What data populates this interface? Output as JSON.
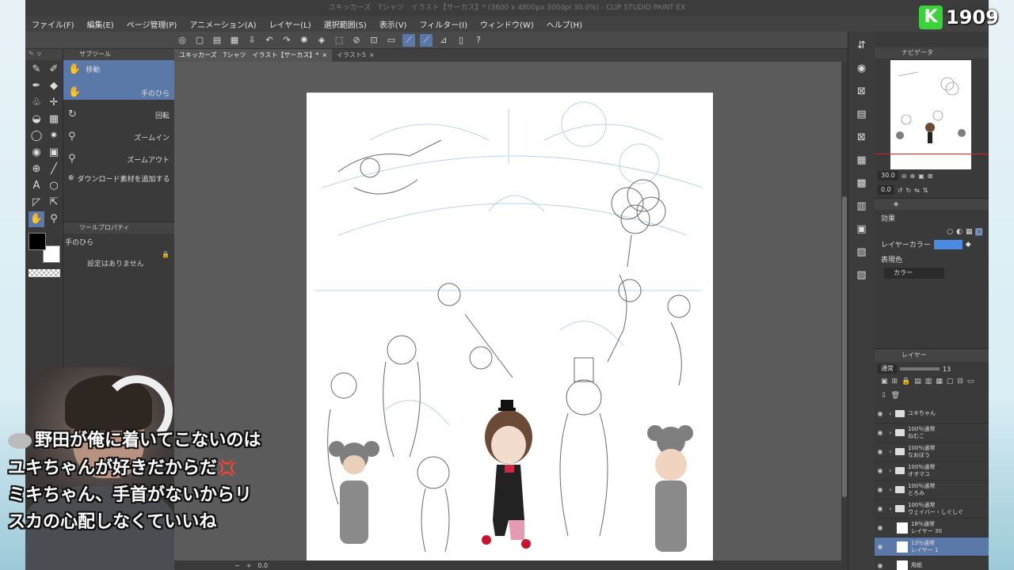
{
  "window": {
    "title": "ユキッカーズ　Tシャツ　イラスト【サーカス】* (3600 x 4800px 300dpi 30.0%)  - CLIP STUDIO PAINT EX"
  },
  "menu": [
    "ファイル(F)",
    "編集(E)",
    "ページ管理(P)",
    "アニメーション(A)",
    "レイヤー(L)",
    "選択範囲(S)",
    "表示(V)",
    "フィルター(I)",
    "ウィンドウ(W)",
    "ヘルプ(H)"
  ],
  "tabs": [
    {
      "label": "ユキッカーズ　Tシャツ　イラスト【サーカス】*",
      "close": "×"
    },
    {
      "label": "イラスト5",
      "close": "×"
    }
  ],
  "subtool": {
    "header": "サブツール",
    "group": "移動",
    "items": [
      "手のひら",
      "回転",
      "ズームイン",
      "ズームアウト"
    ],
    "add_material": "ダウンロード素材を追加する"
  },
  "tool_property": {
    "header": "ツールプロパティ",
    "name": "手のひら",
    "empty": "設定はありません"
  },
  "navigator": {
    "header": "ナビゲータ",
    "zoom": "30.0",
    "angle": "0.0"
  },
  "effects": {
    "header": "効果",
    "layer_color_label": "レイヤーカラー",
    "layer_color_hex": "#4a8ae0",
    "expression_label": "表現色",
    "expression_value": "カラー"
  },
  "layers": {
    "header": "レイヤー",
    "blend": "通常",
    "opacity": "13",
    "rows": [
      {
        "line1": "ユキちゃん",
        "line2": "",
        "type": "folder"
      },
      {
        "line1": "100％通常",
        "line2": "ねむこ",
        "type": "folder"
      },
      {
        "line1": "100％通常",
        "line2": "なおぼう",
        "type": "folder"
      },
      {
        "line1": "100％通常",
        "line2": "オオマユ",
        "type": "folder"
      },
      {
        "line1": "100％通常",
        "line2": "とろみ",
        "type": "folder"
      },
      {
        "line1": "100％通常",
        "line2": "ウェイバー・しぐしぐ",
        "type": "folder"
      },
      {
        "line1": "18％通常",
        "line2": "レイヤー 30",
        "type": "raster"
      },
      {
        "line1": "13％通常",
        "line2": "レイヤー 1",
        "type": "raster",
        "selected": true
      },
      {
        "line1": "用紙",
        "line2": "",
        "type": "paper"
      }
    ]
  },
  "statusbar": {
    "zoom": "0.0"
  },
  "logo": {
    "letter": "K",
    "number": "1909"
  },
  "subtitles": {
    "line1": "野田が俺に着いてこないのは",
    "line2": "ユキちゃんが好きだからだ",
    "line3": "ミキちゃん、手首がないからリ",
    "line4": "スカの心配しなくていいね"
  },
  "icons": {
    "anger": "💢"
  }
}
